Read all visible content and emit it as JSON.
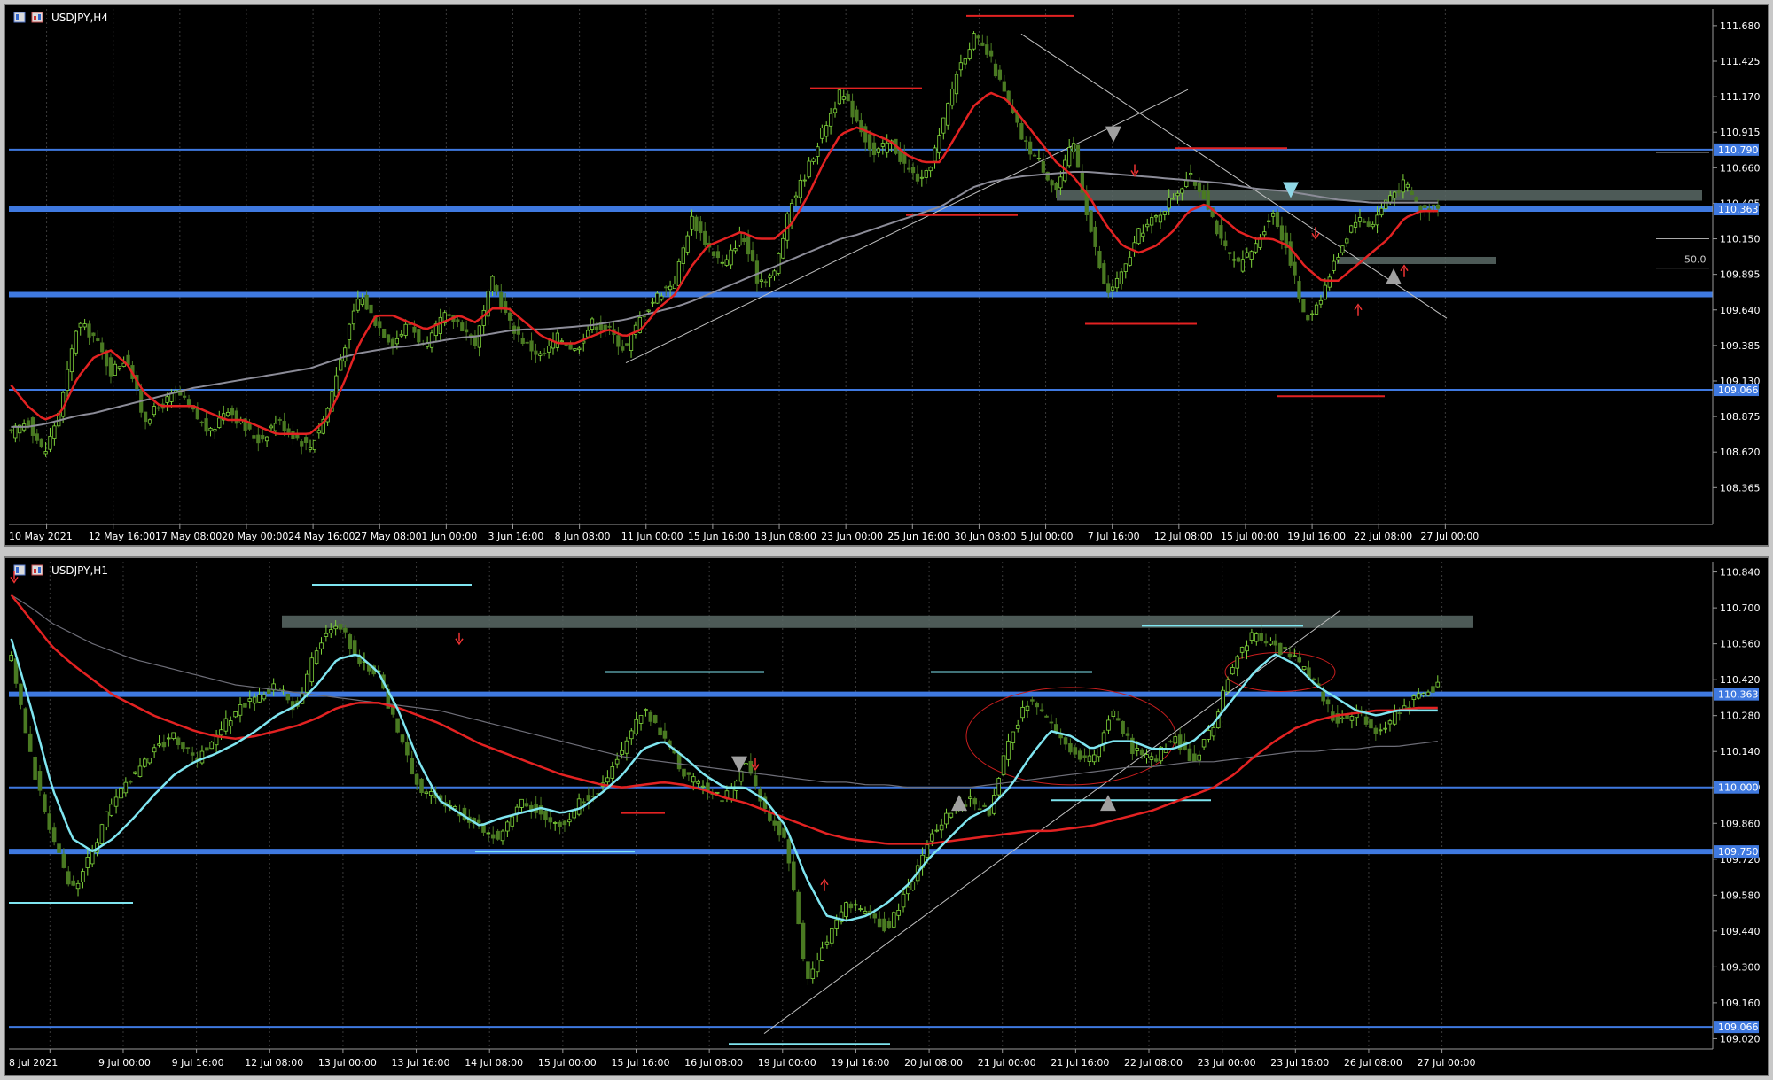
{
  "colors": {
    "background": "#000000",
    "frame": "#c8c8c8",
    "candle_up": "#7fd43a",
    "candle_down": "#4a7a22",
    "ma_fast": "#e32222",
    "ma_slow": "#8c8c98",
    "ma_h1_fast": "#7fe5f0",
    "support": "#3f79e0",
    "zone": "#5a6a66",
    "price_box": "#3f79e0",
    "price_box_text": "#ffffff"
  },
  "chart_data": [
    {
      "type": "candlestick",
      "symbol_label": "USDJPY,H4",
      "ylim": [
        108.1,
        111.8
      ],
      "y_ticks": [
        "111.680",
        "111.425",
        "111.170",
        "110.915",
        "110.660",
        "110.405",
        "110.150",
        "109.895",
        "109.640",
        "109.385",
        "109.130",
        "108.875",
        "108.620",
        "108.365"
      ],
      "x_ticks": [
        "10 May 2021",
        "12 May 16:00",
        "17 May 08:00",
        "20 May 00:00",
        "24 May 16:00",
        "27 May 08:00",
        "1 Jun 00:00",
        "3 Jun 16:00",
        "8 Jun 08:00",
        "11 Jun 00:00",
        "15 Jun 16:00",
        "18 Jun 08:00",
        "23 Jun 00:00",
        "25 Jun 16:00",
        "30 Jun 08:00",
        "5 Jul 00:00",
        "7 Jul 16:00",
        "12 Jul 08:00",
        "15 Jul 00:00",
        "19 Jul 16:00",
        "22 Jul 08:00",
        "27 Jul 00:00"
      ],
      "close_path": [
        108.75,
        108.85,
        108.6,
        108.95,
        109.55,
        109.45,
        109.2,
        109.3,
        108.85,
        108.95,
        109.05,
        108.9,
        108.75,
        108.95,
        108.8,
        108.7,
        108.85,
        108.75,
        108.65,
        108.9,
        109.35,
        109.75,
        109.55,
        109.4,
        109.55,
        109.35,
        109.6,
        109.55,
        109.4,
        109.85,
        109.55,
        109.4,
        109.3,
        109.45,
        109.35,
        109.55,
        109.5,
        109.35,
        109.6,
        109.75,
        109.85,
        110.3,
        110.1,
        109.95,
        110.2,
        109.85,
        109.9,
        110.4,
        110.65,
        110.95,
        111.2,
        111.0,
        110.75,
        110.85,
        110.65,
        110.55,
        110.9,
        111.35,
        111.6,
        111.45,
        111.15,
        110.85,
        110.7,
        110.5,
        110.85,
        110.25,
        109.75,
        109.9,
        110.2,
        110.3,
        110.45,
        110.6,
        110.45,
        110.1,
        109.95,
        110.1,
        110.35,
        110.05,
        109.55,
        109.75,
        110.05,
        110.3,
        110.25,
        110.45,
        110.55,
        110.35,
        110.4
      ],
      "ma_fast_path": [
        109.1,
        108.95,
        108.85,
        108.9,
        109.15,
        109.3,
        109.35,
        109.25,
        109.05,
        108.95,
        108.95,
        108.95,
        108.9,
        108.85,
        108.85,
        108.8,
        108.75,
        108.75,
        108.75,
        108.85,
        109.1,
        109.4,
        109.6,
        109.6,
        109.55,
        109.5,
        109.55,
        109.6,
        109.55,
        109.65,
        109.65,
        109.55,
        109.45,
        109.4,
        109.4,
        109.45,
        109.5,
        109.45,
        109.5,
        109.65,
        109.75,
        109.95,
        110.1,
        110.15,
        110.2,
        110.15,
        110.15,
        110.25,
        110.45,
        110.7,
        110.9,
        110.95,
        110.9,
        110.85,
        110.75,
        110.7,
        110.7,
        110.9,
        111.1,
        111.2,
        111.15,
        111.0,
        110.85,
        110.7,
        110.6,
        110.45,
        110.25,
        110.1,
        110.05,
        110.1,
        110.2,
        110.35,
        110.4,
        110.3,
        110.2,
        110.15,
        110.15,
        110.1,
        109.95,
        109.85,
        109.85,
        109.95,
        110.05,
        110.15,
        110.3,
        110.35,
        110.35
      ],
      "ma_slow_path": [
        108.8,
        108.8,
        108.82,
        108.85,
        108.88,
        108.9,
        108.93,
        108.96,
        108.99,
        109.02,
        109.05,
        109.08,
        109.1,
        109.12,
        109.14,
        109.16,
        109.18,
        109.2,
        109.22,
        109.26,
        109.3,
        109.33,
        109.35,
        109.37,
        109.38,
        109.4,
        109.42,
        109.44,
        109.45,
        109.47,
        109.49,
        109.5,
        109.5,
        109.51,
        109.52,
        109.53,
        109.55,
        109.57,
        109.6,
        109.63,
        109.66,
        109.7,
        109.75,
        109.8,
        109.85,
        109.9,
        109.95,
        110.0,
        110.05,
        110.1,
        110.15,
        110.18,
        110.22,
        110.26,
        110.3,
        110.34,
        110.38,
        110.45,
        110.52,
        110.56,
        110.58,
        110.6,
        110.61,
        110.62,
        110.63,
        110.63,
        110.62,
        110.61,
        110.6,
        110.59,
        110.58,
        110.57,
        110.56,
        110.55,
        110.53,
        110.51,
        110.5,
        110.49,
        110.47,
        110.45,
        110.43,
        110.42,
        110.41,
        110.41,
        110.41,
        110.41,
        110.41
      ],
      "hlines": [
        {
          "price": 110.79,
          "label": "110.790",
          "weight": "thin"
        },
        {
          "price": 110.363,
          "label": "110.363",
          "weight": "thick"
        },
        {
          "price": 109.75,
          "label": "",
          "weight": "thick"
        },
        {
          "price": 109.066,
          "label": "109.066",
          "weight": "thin"
        }
      ],
      "current_price_label": "110.363",
      "fib_label": "50.0"
    },
    {
      "type": "candlestick",
      "symbol_label": "USDJPY,H1",
      "ylim": [
        108.98,
        110.88
      ],
      "y_ticks": [
        "110.840",
        "110.700",
        "110.560",
        "110.420",
        "110.280",
        "110.140",
        "110.000",
        "109.860",
        "109.720",
        "109.580",
        "109.440",
        "109.300",
        "109.160",
        "109.020"
      ],
      "x_ticks": [
        "8 Jul 2021",
        "9 Jul 00:00",
        "9 Jul 16:00",
        "12 Jul 08:00",
        "13 Jul 00:00",
        "13 Jul 16:00",
        "14 Jul 08:00",
        "15 Jul 00:00",
        "15 Jul 16:00",
        "16 Jul 08:00",
        "19 Jul 00:00",
        "19 Jul 16:00",
        "20 Jul 08:00",
        "21 Jul 00:00",
        "21 Jul 16:00",
        "22 Jul 08:00",
        "23 Jul 00:00",
        "23 Jul 16:00",
        "26 Jul 08:00",
        "27 Jul 00:00"
      ],
      "close_path": [
        110.5,
        110.1,
        109.8,
        109.6,
        109.75,
        109.95,
        110.05,
        110.15,
        110.2,
        110.1,
        110.2,
        110.3,
        110.35,
        110.4,
        110.3,
        110.55,
        110.65,
        110.5,
        110.45,
        110.2,
        110.0,
        109.95,
        109.9,
        109.85,
        109.8,
        109.95,
        109.9,
        109.85,
        109.95,
        110.0,
        110.15,
        110.3,
        110.2,
        110.05,
        110.0,
        109.95,
        110.1,
        109.9,
        109.8,
        109.25,
        109.4,
        109.55,
        109.5,
        109.45,
        109.6,
        109.8,
        109.9,
        109.95,
        109.9,
        110.2,
        110.35,
        110.25,
        110.15,
        110.1,
        110.3,
        110.15,
        110.1,
        110.2,
        110.1,
        110.25,
        110.5,
        110.6,
        110.55,
        110.5,
        110.4,
        110.25,
        110.3,
        110.2,
        110.3,
        110.35,
        110.4
      ],
      "ma_fast_path": [
        110.58,
        110.3,
        110.0,
        109.8,
        109.75,
        109.8,
        109.88,
        109.97,
        110.05,
        110.1,
        110.13,
        110.17,
        110.22,
        110.28,
        110.32,
        110.4,
        110.5,
        110.52,
        110.45,
        110.3,
        110.1,
        109.95,
        109.9,
        109.85,
        109.88,
        109.9,
        109.92,
        109.9,
        109.92,
        109.98,
        110.05,
        110.15,
        110.18,
        110.12,
        110.05,
        110.0,
        110.0,
        109.95,
        109.85,
        109.65,
        109.5,
        109.48,
        109.5,
        109.55,
        109.62,
        109.72,
        109.8,
        109.88,
        109.92,
        110.0,
        110.12,
        110.22,
        110.2,
        110.15,
        110.18,
        110.18,
        110.15,
        110.15,
        110.18,
        110.25,
        110.35,
        110.45,
        110.52,
        110.48,
        110.4,
        110.35,
        110.3,
        110.28,
        110.3,
        110.3,
        110.3
      ],
      "ma_mid_path": [
        110.75,
        110.65,
        110.55,
        110.48,
        110.42,
        110.36,
        110.32,
        110.28,
        110.25,
        110.22,
        110.2,
        110.19,
        110.2,
        110.22,
        110.24,
        110.27,
        110.31,
        110.33,
        110.33,
        110.31,
        110.28,
        110.25,
        110.21,
        110.17,
        110.14,
        110.11,
        110.08,
        110.05,
        110.03,
        110.01,
        110.0,
        110.01,
        110.02,
        110.01,
        109.99,
        109.96,
        109.94,
        109.91,
        109.88,
        109.85,
        109.82,
        109.8,
        109.79,
        109.78,
        109.78,
        109.78,
        109.79,
        109.8,
        109.81,
        109.82,
        109.83,
        109.83,
        109.84,
        109.85,
        109.87,
        109.89,
        109.91,
        109.94,
        109.97,
        110.0,
        110.05,
        110.12,
        110.18,
        110.23,
        110.26,
        110.28,
        110.29,
        110.3,
        110.3,
        110.31,
        110.31
      ],
      "ma_slow_path": [
        110.75,
        110.7,
        110.64,
        110.6,
        110.56,
        110.53,
        110.5,
        110.48,
        110.46,
        110.44,
        110.42,
        110.4,
        110.39,
        110.38,
        110.37,
        110.36,
        110.35,
        110.34,
        110.33,
        110.32,
        110.31,
        110.3,
        110.28,
        110.26,
        110.24,
        110.22,
        110.2,
        110.18,
        110.16,
        110.14,
        110.12,
        110.11,
        110.1,
        110.09,
        110.08,
        110.07,
        110.06,
        110.05,
        110.04,
        110.03,
        110.02,
        110.02,
        110.01,
        110.01,
        110.0,
        110.0,
        110.0,
        110.0,
        110.01,
        110.02,
        110.03,
        110.04,
        110.05,
        110.06,
        110.07,
        110.08,
        110.08,
        110.09,
        110.1,
        110.1,
        110.11,
        110.12,
        110.13,
        110.14,
        110.14,
        110.15,
        110.15,
        110.16,
        110.16,
        110.17,
        110.18
      ],
      "hlines": [
        {
          "price": 110.363,
          "label": "110.363",
          "weight": "thick"
        },
        {
          "price": 110.0,
          "label": "110.000",
          "weight": "thin"
        },
        {
          "price": 109.75,
          "label": "109.750",
          "weight": "thick"
        },
        {
          "price": 109.066,
          "label": "109.066",
          "weight": "thin"
        }
      ],
      "current_price_label": "110.363"
    }
  ]
}
